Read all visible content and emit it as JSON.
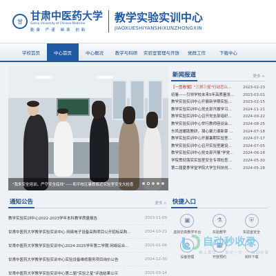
{
  "header": {
    "seal_glyph": "甘",
    "university_name": "甘肃中医药大学",
    "university_en": "Gansu University of Chinese Medicine",
    "motto": "勤奋 严谨 继承 创新",
    "site_title": "教学实验实训中心",
    "site_pinyin": "JIAOXUESHIYANSHIXUNZHONGXIN"
  },
  "nav": {
    "items": [
      "学校首页",
      "中心首页",
      "中心概况",
      "教学与科研",
      "实验室管理与开放",
      "党群工作",
      "下载中心"
    ],
    "active_index": 1
  },
  "slider": {
    "caption": "\"我来安全培训，严守安全底线\"——和平校区暑假临近实验室安全大检查",
    "dot_count": 5,
    "active_dot": 1
  },
  "news": {
    "title": "新闻报道",
    "more": "更多 >",
    "items": [
      {
        "title": "【一图看懂】\"三抓三促\"行动怎么干？",
        "date": "2023-02-23"
      },
      {
        "title": "初暑——引领学校未来5年高质量发展的…",
        "date": "2023-03-01"
      },
      {
        "title": "教学实验实训中心开展新学期实验室安全…",
        "date": "2023-02-15"
      },
      {
        "title": "教学实验实训中心党支部开展学习贯彻\"党的…",
        "date": "2024-11-21"
      },
      {
        "title": "教学实验实训中心召开党支部组织生活会…",
        "date": "2024-09-22"
      },
      {
        "title": "教学实验实训中心举行教师座谈会暨主题…",
        "date": "2024-08-25"
      },
      {
        "title": "东风送暖助教研，凝心聚力谱新章 教学实…",
        "date": "2024-07-18"
      },
      {
        "title": "教学实验实训中心开展暑期实验室安全检查",
        "date": "2024-07-17"
      },
      {
        "title": "教学实验实训中心召开实验室建设工作会",
        "date": "2024-07-05"
      },
      {
        "title": "教学实验实训中心党支部开展\"学党纪 明…",
        "date": "2024-06-18"
      },
      {
        "title": "学院贯彻落实实验室安全专项检查工作…",
        "date": "2024-05-30"
      },
      {
        "title": "第二届夏季学堂学院大学生科技创新活动…",
        "date": "2024-05-28"
      }
    ]
  },
  "notice": {
    "title": "通知公告",
    "more": "更多 >",
    "items": [
      {
        "title": "教学实验实训中心2022-2023学年本科教学质量报告",
        "date": "2023-11-09"
      },
      {
        "title": "甘肃中医药大学教学实验实训中心 网络电子设备采购项目公开招标采购公告",
        "date": "2024-10-21"
      },
      {
        "title": "甘肃中医药大学教学实验实训中心2024-2025学年第二学期 网络综合查询服务项目公告",
        "date": "2025-01-06"
      },
      {
        "title": "甘肃中医药大学教学实验实训中心实验设备维修服务项目询价公告",
        "date": "2024-12-30"
      },
      {
        "title": "甘肃中医药大学教学实验实训中心第二届\"实验之星\"评选结果公示",
        "date": "2025-03-14"
      }
    ]
  },
  "quick": {
    "title": "快捷入口",
    "items": [
      {
        "label": "虚拟仿真教学平台",
        "icon": "monitor-icon"
      },
      {
        "label": "实验教学",
        "icon": "flask-icon"
      },
      {
        "label": "实验室安全",
        "icon": "shield-icon"
      },
      {
        "label": "设备管理",
        "icon": "gear-icon"
      },
      {
        "label": "开放预约",
        "icon": "calendar-icon"
      },
      {
        "label": "资料下载",
        "icon": "download-icon"
      }
    ]
  },
  "watermark": {
    "text": "自动秒收录",
    "sub": "做上首页 一 来访一次 一 自动收录"
  },
  "colors": {
    "brand": "#1f5aa3",
    "accent_red": "#c0392b",
    "watermark": "#6bc3ea"
  }
}
